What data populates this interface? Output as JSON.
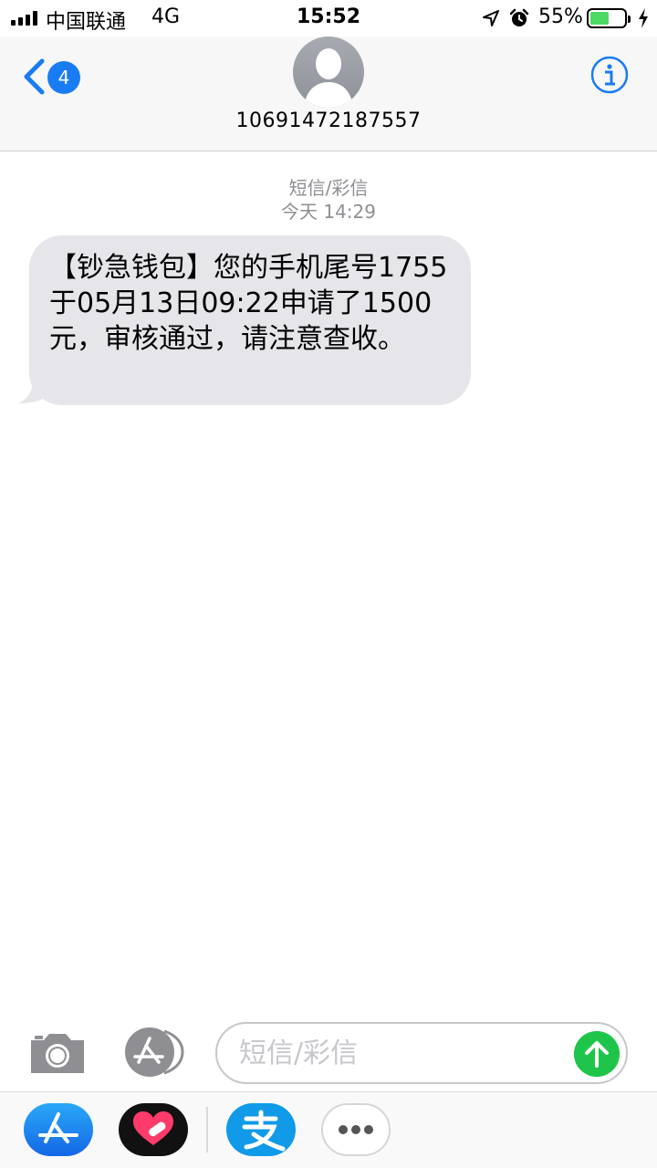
{
  "status_bar": {
    "carrier": "中国联通",
    "network": "4G",
    "time": "15:52",
    "battery_percent": "55%",
    "battery_level": 0.55,
    "icons": [
      "signal-icon",
      "location-icon",
      "alarm-icon",
      "battery-icon",
      "charging-icon"
    ]
  },
  "header": {
    "back_badge": "4",
    "contact": "10691472187557",
    "icons": [
      "back-chevron-icon",
      "avatar-icon",
      "info-icon"
    ]
  },
  "conversation": {
    "message_type": "短信/彩信",
    "timestamp": "今天 14:29",
    "messages": [
      {
        "direction": "incoming",
        "text": "【钞急钱包】您的手机尾号1755于05月13日09:22申请了1500元，审核通过，请注意查收。"
      }
    ]
  },
  "composer": {
    "placeholder": "短信/彩信",
    "icons": [
      "camera-icon",
      "app-store-icon",
      "send-arrow-icon"
    ]
  },
  "app_drawer": {
    "apps": [
      "app-store-icon",
      "digital-touch-heart-icon",
      "alipay-icon",
      "more-icon"
    ]
  },
  "colors": {
    "accent_blue": "#1a7cf5",
    "bubble_gray": "#e5e5ea",
    "send_green": "#1ec54a",
    "battery_green": "#4cd964",
    "meta_gray": "#8e8e93"
  }
}
